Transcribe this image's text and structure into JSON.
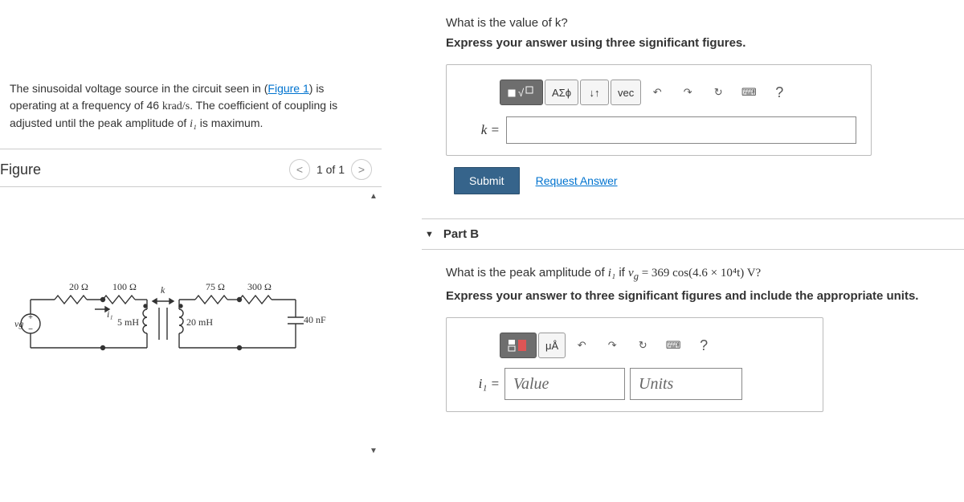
{
  "problem": {
    "intro_pre": "The sinusoidal voltage source in the circuit seen in (",
    "figure_link": "Figure 1",
    "intro_mid": ") is operating at a frequency of 46 ",
    "freq_unit": "krad/s",
    "intro_post": ". The coefficient of coupling is adjusted until the peak amplitude of ",
    "i1": "i₁",
    "intro_end": " is maximum."
  },
  "figure": {
    "title": "Figure",
    "nav_label": "1 of 1",
    "values": {
      "r1": "20 Ω",
      "r2": "100 Ω",
      "r3": "75 Ω",
      "r4": "300 Ω",
      "l1": "5 mH",
      "l2": "20 mH",
      "c1": "40 nF",
      "k": "k",
      "i1": "i₁",
      "vg": "vg"
    }
  },
  "partA": {
    "question": "What is the value of k?",
    "instruction": "Express your answer using three significant figures.",
    "toolbar": {
      "templates": "▭√▭",
      "greek": "ΑΣϕ",
      "subsup": "↓↑",
      "vec": "vec",
      "help": "?"
    },
    "label": "k =",
    "submit": "Submit",
    "request": "Request Answer"
  },
  "partB": {
    "title": "Part B",
    "question_pre": "What is the peak amplitude of ",
    "i1": "i₁",
    "question_mid": " if ",
    "vg": "v",
    "vg_sub": "g",
    "eq": " = 369 cos(4.6 × 10⁴t) V?",
    "instruction": "Express your answer to three significant figures and include the appropriate units.",
    "toolbar": {
      "units": "μÅ",
      "help": "?"
    },
    "label": "i₁ =",
    "value_ph": "Value",
    "units_ph": "Units"
  }
}
